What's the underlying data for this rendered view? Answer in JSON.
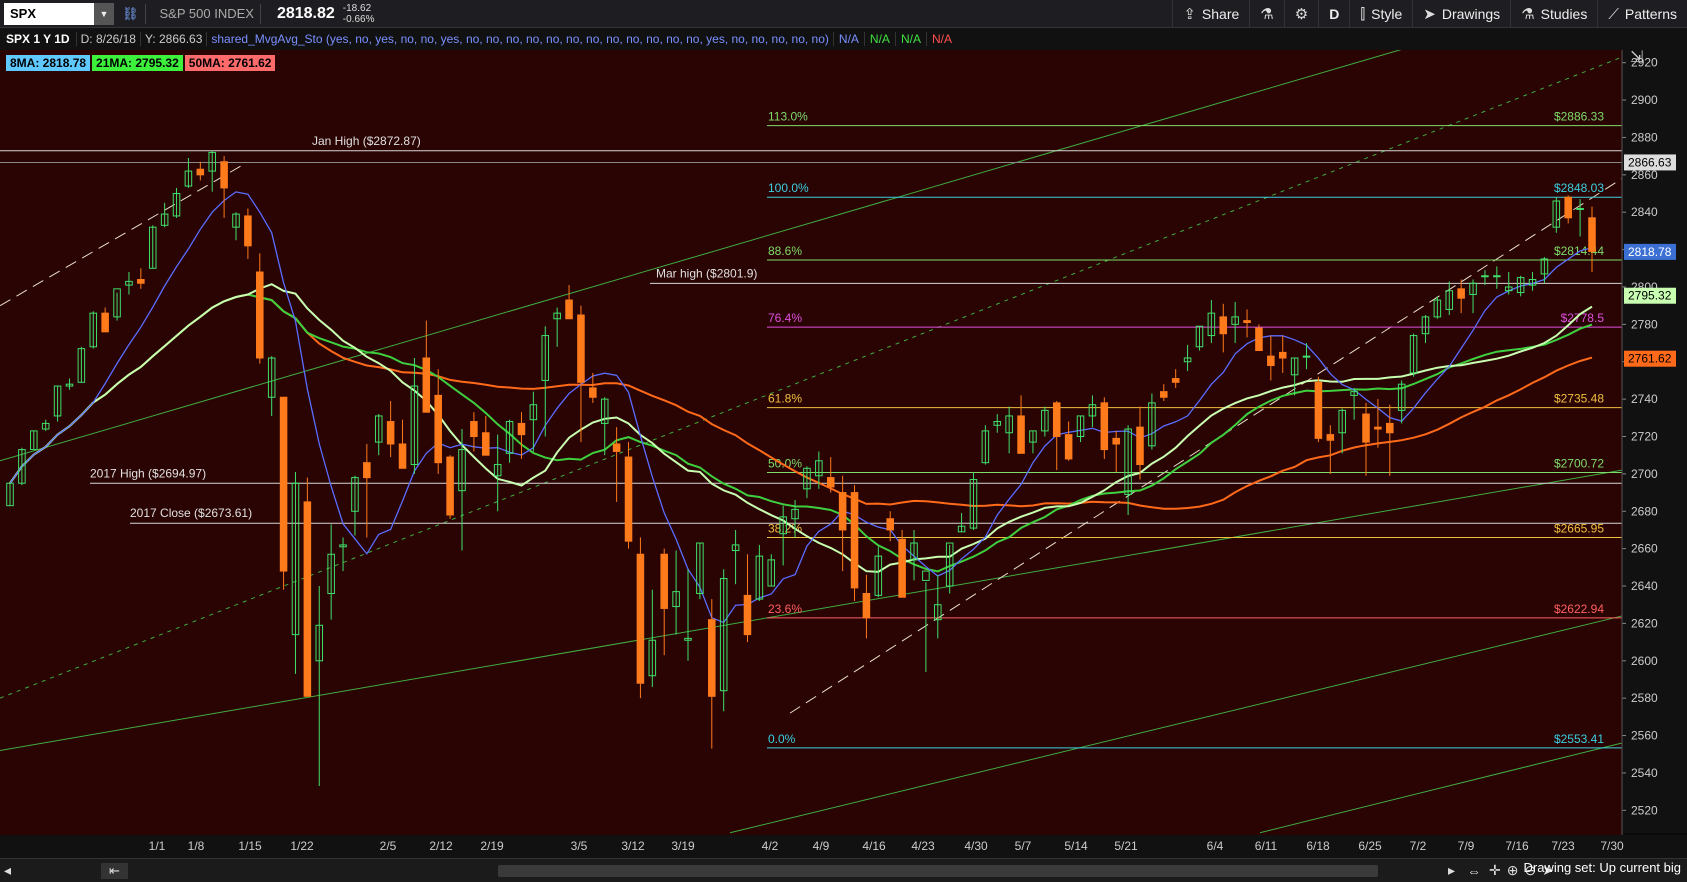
{
  "toolbar": {
    "symbol": "SPX",
    "index_name": "S&P 500 INDEX",
    "last_price": "2818.82",
    "change": "-18.62",
    "change_pct": "-0.66%",
    "buttons": [
      {
        "label": "Share",
        "icon": "share-icon"
      },
      {
        "label": "",
        "icon": "flask-icon"
      },
      {
        "label": "",
        "icon": "gear-icon"
      },
      {
        "label": "D",
        "icon": ""
      },
      {
        "label": "Style",
        "icon": "style-icon"
      },
      {
        "label": "Drawings",
        "icon": "cursor-icon"
      },
      {
        "label": "Studies",
        "icon": "flask-icon"
      },
      {
        "label": "Patterns",
        "icon": "pattern-icon"
      }
    ]
  },
  "infobar": {
    "symbol_period": "SPX 1 Y 1D",
    "date": "D: 8/26/18",
    "y_value": "Y: 2866.63",
    "study": "shared_MvgAvg_Sto (yes, no, yes, no, no, yes, no, no, no, no, no, no, no, no, no, no, no, no, yes, no, no, no, no, no)",
    "na_values": [
      "N/A",
      "N/A",
      "N/A",
      "N/A"
    ],
    "na_colors": [
      "#7a90ff",
      "#40e040",
      "#40e040",
      "#ff5050"
    ]
  },
  "legend": [
    {
      "label": "8MA: 2818.78",
      "color": "#5fc8ff"
    },
    {
      "label": "21MA: 2795.32",
      "color": "#3cf03c"
    },
    {
      "label": "50MA: 2761.62",
      "color": "#ff6a6a"
    }
  ],
  "price_axis": {
    "ticks": [
      2520,
      2540,
      2560,
      2580,
      2600,
      2620,
      2640,
      2660,
      2680,
      2700,
      2720,
      2740,
      2760,
      2780,
      2800,
      2820,
      2840,
      2860,
      2880,
      2900,
      2920
    ],
    "badges": [
      {
        "value": 2866.63,
        "label": "2866.63",
        "bg": "#dddddd",
        "fg": "#000000"
      },
      {
        "value": 2818.78,
        "label": "2818.78",
        "bg": "#3b6fd4",
        "fg": "#ffffff"
      },
      {
        "value": 2795.32,
        "label": "2795.32",
        "bg": "#c8ffb0",
        "fg": "#000000"
      },
      {
        "value": 2761.62,
        "label": "2761.62",
        "bg": "#ff6a1a",
        "fg": "#000000"
      }
    ]
  },
  "date_axis": [
    "1/1",
    "1/8",
    "1/15",
    "1/22",
    "2/5",
    "2/12",
    "2/19",
    "3/5",
    "3/12",
    "3/19",
    "4/2",
    "4/9",
    "4/16",
    "4/23",
    "4/30",
    "5/7",
    "5/14",
    "5/21",
    "6/4",
    "6/11",
    "6/18",
    "6/25",
    "7/2",
    "7/9",
    "7/16",
    "7/23",
    "7/30"
  ],
  "fib_levels": [
    {
      "pct": "113.0%",
      "value": 2886.33,
      "label": "$2886.33",
      "color": "#7fdc6a"
    },
    {
      "pct": "100.0%",
      "value": 2848.03,
      "label": "$2848.03",
      "color": "#3ad0e0"
    },
    {
      "pct": "88.6%",
      "value": 2814.44,
      "label": "$2814.44",
      "color": "#7fdc6a"
    },
    {
      "pct": "76.4%",
      "value": 2778.5,
      "label": "$2778.5",
      "color": "#e050e0"
    },
    {
      "pct": "61.8%",
      "value": 2735.48,
      "label": "$2735.48",
      "color": "#f0c040"
    },
    {
      "pct": "50.0%",
      "value": 2700.72,
      "label": "$2700.72",
      "color": "#7fdc6a"
    },
    {
      "pct": "38.2%",
      "value": 2665.95,
      "label": "$2665.95",
      "color": "#f0c040"
    },
    {
      "pct": "23.6%",
      "value": 2622.94,
      "label": "$2622.94",
      "color": "#ff6060"
    },
    {
      "pct": "0.0%",
      "value": 2553.41,
      "label": "$2553.41",
      "color": "#3ad0e0"
    }
  ],
  "annotations": [
    {
      "text": "Jan High ($2872.87)",
      "value": 2872.87
    },
    {
      "text": "Mar high ($2801.9)",
      "value": 2801.9
    },
    {
      "text": "2017 High ($2694.97)",
      "value": 2694.97
    },
    {
      "text": "2017 Close ($2673.61)",
      "value": 2673.61
    }
  ],
  "chart_data": {
    "type": "candlestick",
    "ylim": [
      2510,
      2930
    ],
    "candles": [
      [
        2683,
        2695,
        2683,
        2695
      ],
      [
        2695,
        2714,
        2694,
        2713
      ],
      [
        2713,
        2723,
        2713,
        2723
      ],
      [
        2724,
        2729,
        2723,
        2727
      ],
      [
        2731,
        2747,
        2728,
        2747
      ],
      [
        2747,
        2751,
        2745,
        2748
      ],
      [
        2749,
        2768,
        2749,
        2767
      ],
      [
        2768,
        2787,
        2767,
        2786
      ],
      [
        2786,
        2789,
        2776,
        2776
      ],
      [
        2784,
        2797,
        2782,
        2799
      ],
      [
        2801,
        2808,
        2796,
        2803
      ],
      [
        2804,
        2810,
        2799,
        2802
      ],
      [
        2810,
        2833,
        2810,
        2832
      ],
      [
        2833,
        2845,
        2832,
        2839
      ],
      [
        2838,
        2853,
        2837,
        2850
      ],
      [
        2854,
        2869,
        2853,
        2862
      ],
      [
        2863,
        2867,
        2857,
        2860
      ],
      [
        2862,
        2873,
        2851,
        2872
      ],
      [
        2867,
        2870,
        2837,
        2853
      ],
      [
        2832,
        2840,
        2825,
        2839
      ],
      [
        2838,
        2842,
        2815,
        2822
      ],
      [
        2808,
        2818,
        2759,
        2762
      ],
      [
        2741,
        2763,
        2731,
        2762
      ],
      [
        2741,
        2727,
        2638,
        2648
      ],
      [
        2614,
        2701,
        2593,
        2695
      ],
      [
        2685,
        2698,
        2581,
        2581
      ],
      [
        2600,
        2640,
        2533,
        2619
      ],
      [
        2636,
        2673,
        2622,
        2657
      ],
      [
        2661,
        2666,
        2648,
        2662
      ],
      [
        2680,
        2699,
        2667,
        2698
      ],
      [
        2706,
        2716,
        2666,
        2698
      ],
      [
        2717,
        2732,
        2710,
        2731
      ],
      [
        2728,
        2739,
        2709,
        2716
      ],
      [
        2716,
        2729,
        2703,
        2703
      ],
      [
        2705,
        2762,
        2700,
        2747
      ],
      [
        2762,
        2782,
        2733,
        2733
      ],
      [
        2742,
        2756,
        2700,
        2706
      ],
      [
        2709,
        2710,
        2676,
        2678
      ],
      [
        2691,
        2724,
        2659,
        2713
      ],
      [
        2728,
        2733,
        2712,
        2720
      ],
      [
        2722,
        2731,
        2710,
        2710
      ],
      [
        2699,
        2721,
        2680,
        2705
      ],
      [
        2711,
        2729,
        2706,
        2728
      ],
      [
        2727,
        2733,
        2708,
        2721
      ],
      [
        2729,
        2744,
        2712,
        2737
      ],
      [
        2750,
        2779,
        2720,
        2774
      ],
      [
        2783,
        2789,
        2768,
        2786
      ],
      [
        2793,
        2801,
        2783,
        2783
      ],
      [
        2785,
        2790,
        2717,
        2749
      ],
      [
        2746,
        2754,
        2738,
        2741
      ],
      [
        2727,
        2741,
        2710,
        2740
      ],
      [
        2716,
        2725,
        2685,
        2712
      ],
      [
        2709,
        2717,
        2660,
        2664
      ],
      [
        2657,
        2666,
        2580,
        2588
      ],
      [
        2592,
        2638,
        2586,
        2611
      ],
      [
        2657,
        2660,
        2603,
        2628
      ],
      [
        2629,
        2659,
        2614,
        2637
      ],
      [
        2611,
        2649,
        2600,
        2612
      ],
      [
        2636,
        2663,
        2633,
        2663
      ],
      [
        2622,
        2633,
        2553,
        2581
      ],
      [
        2584,
        2649,
        2573,
        2644
      ],
      [
        2659,
        2670,
        2641,
        2662
      ],
      [
        2635,
        2657,
        2610,
        2614
      ],
      [
        2633,
        2662,
        2632,
        2656
      ],
      [
        2640,
        2657,
        2640,
        2654
      ],
      [
        2668,
        2683,
        2651,
        2677
      ],
      [
        2676,
        2686,
        2666,
        2681
      ],
      [
        2692,
        2704,
        2687,
        2703
      ],
      [
        2699,
        2712,
        2692,
        2707
      ],
      [
        2698,
        2709,
        2690,
        2693
      ],
      [
        2690,
        2699,
        2648,
        2670
      ],
      [
        2690,
        2694,
        2632,
        2639
      ],
      [
        2636,
        2646,
        2612,
        2623
      ],
      [
        2635,
        2661,
        2634,
        2656
      ],
      [
        2676,
        2680,
        2664,
        2670
      ],
      [
        2665,
        2670,
        2634,
        2634
      ],
      [
        2654,
        2670,
        2643,
        2663
      ],
      [
        2643,
        2642,
        2594,
        2648
      ],
      [
        2622,
        2646,
        2612,
        2630
      ],
      [
        2640,
        2662,
        2636,
        2663
      ],
      [
        2669,
        2679,
        2669,
        2672
      ],
      [
        2671,
        2701,
        2670,
        2697
      ],
      [
        2706,
        2726,
        2705,
        2723
      ],
      [
        2726,
        2732,
        2722,
        2728
      ],
      [
        2722,
        2736,
        2711,
        2731
      ],
      [
        2731,
        2742,
        2720,
        2711
      ],
      [
        2717,
        2723,
        2711,
        2723
      ],
      [
        2723,
        2736,
        2720,
        2734
      ],
      [
        2738,
        2739,
        2702,
        2720
      ],
      [
        2721,
        2728,
        2707,
        2708
      ],
      [
        2720,
        2731,
        2717,
        2731
      ],
      [
        2731,
        2742,
        2725,
        2737
      ],
      [
        2738,
        2741,
        2708,
        2713
      ],
      [
        2719,
        2723,
        2701,
        2716
      ],
      [
        2689,
        2726,
        2678,
        2724
      ],
      [
        2725,
        2736,
        2697,
        2705
      ],
      [
        2715,
        2743,
        2713,
        2738
      ],
      [
        2744,
        2748,
        2739,
        2741
      ],
      [
        2751,
        2756,
        2746,
        2749
      ],
      [
        2760,
        2769,
        2755,
        2762
      ],
      [
        2768,
        2779,
        2766,
        2779
      ],
      [
        2774,
        2793,
        2770,
        2786
      ],
      [
        2784,
        2791,
        2765,
        2775
      ],
      [
        2780,
        2792,
        2770,
        2784
      ],
      [
        2782,
        2788,
        2773,
        2781
      ],
      [
        2778,
        2780,
        2766,
        2766
      ],
      [
        2763,
        2774,
        2750,
        2758
      ],
      [
        2765,
        2774,
        2754,
        2762
      ],
      [
        2753,
        2762,
        2742,
        2762
      ],
      [
        2763,
        2770,
        2756,
        2763
      ],
      [
        2749,
        2752,
        2717,
        2719
      ],
      [
        2721,
        2726,
        2700,
        2718
      ],
      [
        2722,
        2735,
        2711,
        2734
      ],
      [
        2742,
        2746,
        2729,
        2744
      ],
      [
        2732,
        2738,
        2699,
        2717
      ],
      [
        2725,
        2740,
        2714,
        2724
      ],
      [
        2727,
        2737,
        2699,
        2722
      ],
      [
        2734,
        2750,
        2727,
        2748
      ],
      [
        2754,
        2775,
        2752,
        2774
      ],
      [
        2775,
        2785,
        2770,
        2784
      ],
      [
        2784,
        2795,
        2783,
        2793
      ],
      [
        2788,
        2803,
        2785,
        2798
      ],
      [
        2799,
        2804,
        2786,
        2794
      ],
      [
        2796,
        2804,
        2786,
        2802
      ],
      [
        2806,
        2809,
        2801,
        2806
      ],
      [
        2806,
        2811,
        2799,
        2806
      ],
      [
        2798,
        2808,
        2796,
        2800
      ],
      [
        2797,
        2806,
        2795,
        2805
      ],
      [
        2801,
        2808,
        2798,
        2804
      ],
      [
        2807,
        2816,
        2802,
        2815
      ],
      [
        2832,
        2848,
        2829,
        2846
      ],
      [
        2848,
        2849,
        2834,
        2837
      ],
      [
        2842,
        2847,
        2827,
        2842
      ],
      [
        2837,
        2843,
        2808,
        2819
      ]
    ]
  }
}
